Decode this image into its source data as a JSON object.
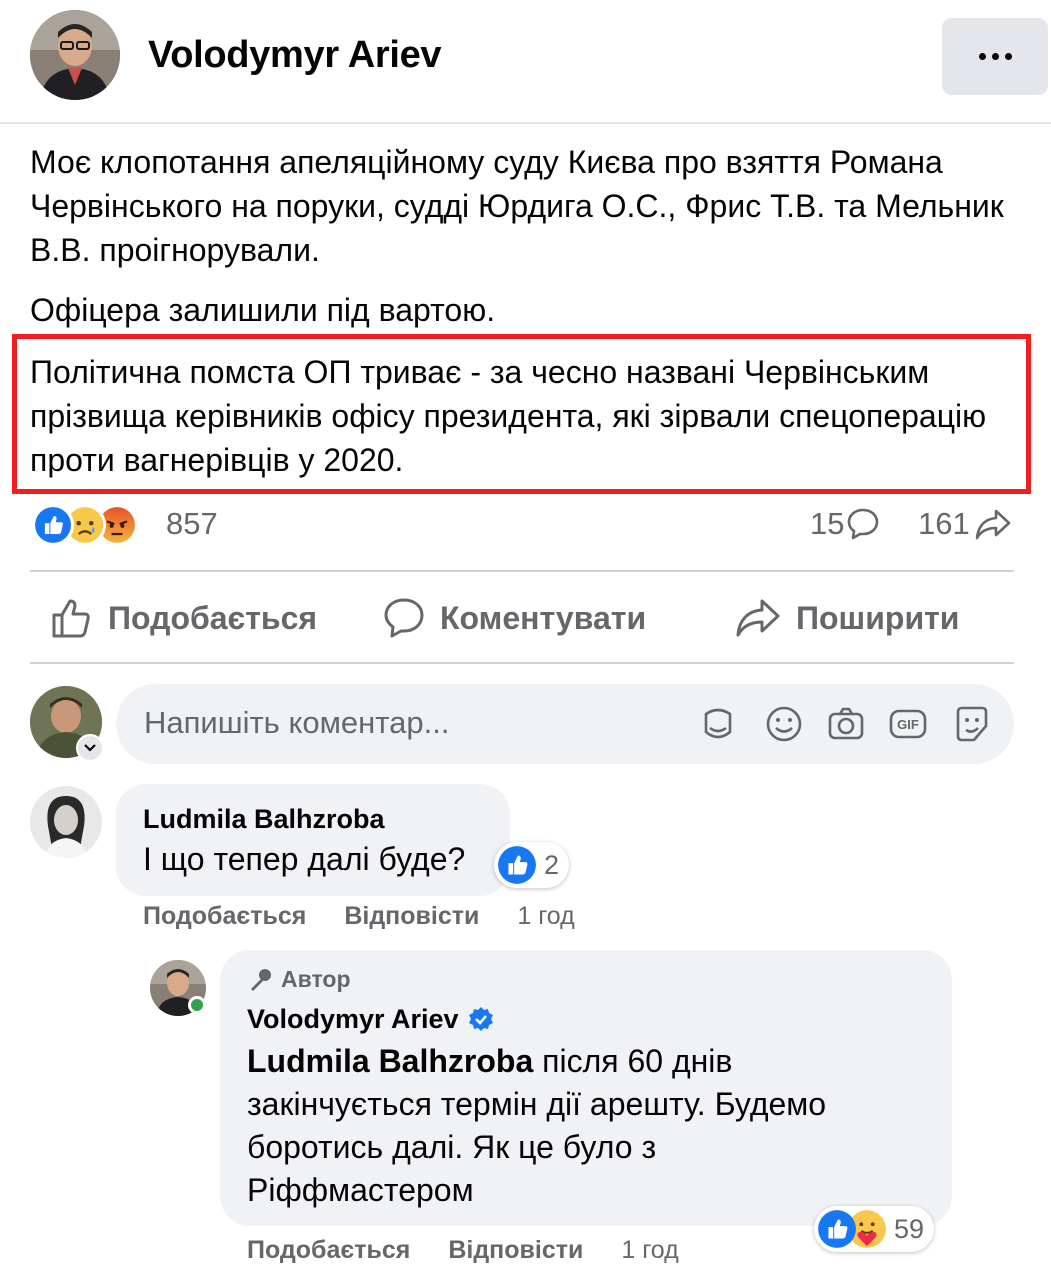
{
  "post": {
    "author": "Volodymyr Ariev",
    "paragraphs": [
      "Моє клопотання апеляційному суду Києва про взяття Романа Червінського на поруки, судді Юрдига О.С., Фрис Т.В. та Мельник В.В. проігнорували.",
      "Офіцера залишили під вартою.",
      "Політична помста ОП триває - за чесно названі Червінським прізвища керівників офісу президента, які зірвали спецоперацію проти вагнерівців у 2020."
    ],
    "reaction_count": "857",
    "comment_count": "15",
    "share_count": "161",
    "reaction_icons": [
      "like-reaction-icon",
      "sad-reaction-icon",
      "angry-reaction-icon"
    ]
  },
  "actions": {
    "like": "Подобається",
    "comment": "Коментувати",
    "share": "Поширити"
  },
  "composer": {
    "placeholder": "Напишіть коментар..."
  },
  "comments": [
    {
      "author": "Ludmila Balhzroba",
      "text": "І що тепер далі буде?",
      "reaction_count": "2",
      "like_label": "Подобається",
      "reply_label": "Відповісти",
      "time": "1 год"
    }
  ],
  "reply": {
    "badge": "Автор",
    "author": "Volodymyr Ariev",
    "mention": "Ludmila Balhzroba",
    "line1": " після 60 днів",
    "line2": "закінчується термін дії арешту. Будемо",
    "line3": "боротись далі. Як це було з",
    "line4": "Ріффмастером",
    "reaction_count": "59",
    "like_label": "Подобається",
    "reply_label": "Відповісти",
    "time": "1 год"
  },
  "colors": {
    "accent": "#1877f2",
    "highlight_border": "#f01e1e",
    "secondary_text": "#65676b",
    "bubble_bg": "#f0f2f5"
  }
}
